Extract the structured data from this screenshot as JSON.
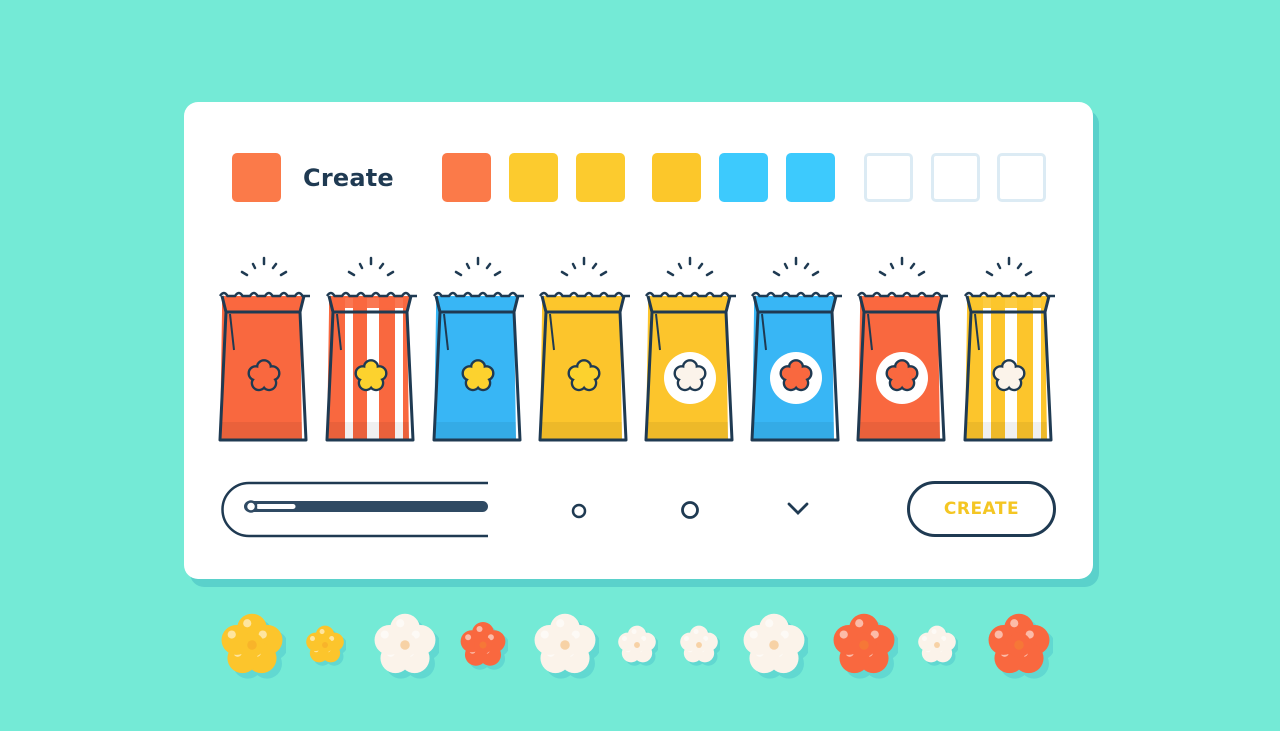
{
  "header": {
    "title": "Create",
    "logo_color": "#fb7a49"
  },
  "palette": {
    "swatches": [
      {
        "name": "orange",
        "color": "#fb7a49",
        "filled": true
      },
      {
        "name": "yellow",
        "color": "#fccb2e",
        "filled": true
      },
      {
        "name": "yellow",
        "color": "#fccb2e",
        "filled": true
      },
      {
        "name": "yellow",
        "color": "#fcc72a",
        "filled": true
      },
      {
        "name": "blue",
        "color": "#3dcafd",
        "filled": true
      },
      {
        "name": "blue",
        "color": "#3dcafd",
        "filled": true
      },
      {
        "name": "empty",
        "color": "#ffffff",
        "filled": false
      },
      {
        "name": "empty",
        "color": "#ffffff",
        "filled": false
      },
      {
        "name": "empty",
        "color": "#ffffff",
        "filled": false
      }
    ]
  },
  "bags": [
    {
      "name": "orange-solid",
      "color": "#f9683f",
      "stripes": false,
      "badge": false,
      "kernel_color": "#f9683f"
    },
    {
      "name": "orange-striped",
      "color": "#f9683f",
      "stripes": true,
      "badge": false,
      "kernel_color": "#fcd22e"
    },
    {
      "name": "blue-solid",
      "color": "#38b6f5",
      "stripes": false,
      "badge": false,
      "kernel_color": "#fcd22e"
    },
    {
      "name": "yellow-solid",
      "color": "#fcc52c",
      "stripes": false,
      "badge": false,
      "kernel_color": "#fcd22e"
    },
    {
      "name": "yellow-badge",
      "color": "#fcc52c",
      "stripes": false,
      "badge": true,
      "kernel_color": "#fbf3ea"
    },
    {
      "name": "blue-badge",
      "color": "#38b6f5",
      "stripes": false,
      "badge": true,
      "kernel_color": "#f9683f"
    },
    {
      "name": "orange-badge",
      "color": "#f9683f",
      "stripes": false,
      "badge": true,
      "kernel_color": "#f9683f"
    },
    {
      "name": "yellow-striped",
      "color": "#fcc52c",
      "stripes": true,
      "badge": false,
      "kernel_color": "#fbf3ea"
    }
  ],
  "controls": {
    "slider_value": 0.06,
    "option_1": "radio",
    "option_2": "radio",
    "dropdown": "chevron-down",
    "create_button_label": "CREATE"
  },
  "popcorn": [
    {
      "color": "#fcc52c",
      "size": "large"
    },
    {
      "color": "#fcc52c",
      "size": "small"
    },
    {
      "color": "#fbf3ea",
      "size": "large"
    },
    {
      "color": "#f9683f",
      "size": "medium"
    },
    {
      "color": "#fbf3ea",
      "size": "large"
    },
    {
      "color": "#fbf3ea",
      "size": "small"
    },
    {
      "color": "#fbf3ea",
      "size": "small"
    },
    {
      "color": "#fbf3ea",
      "size": "large"
    },
    {
      "color": "#f9683f",
      "size": "large"
    },
    {
      "color": "#fbf3ea",
      "size": "small"
    },
    {
      "color": "#f9683f",
      "size": "large"
    }
  ]
}
